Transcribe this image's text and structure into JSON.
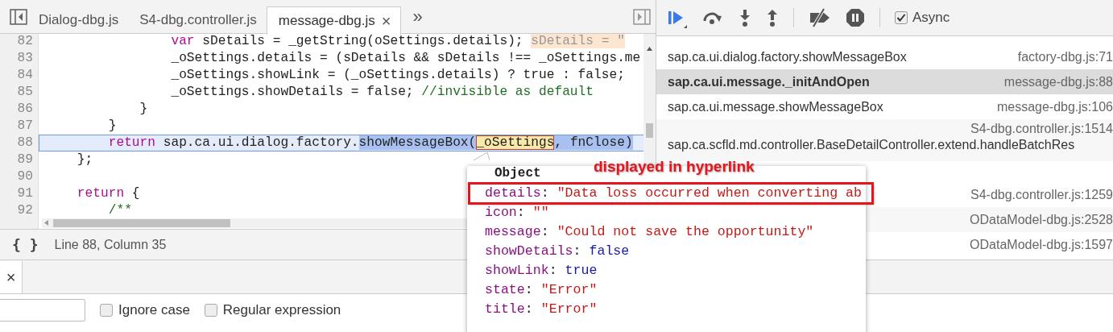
{
  "editor": {
    "tabs": [
      {
        "label": "Dialog-dbg.js",
        "selected": false
      },
      {
        "label": "S4-dbg.controller.js",
        "selected": false
      },
      {
        "label": "message-dbg.js",
        "selected": true,
        "close_glyph": "×"
      }
    ],
    "more_glyph": "»",
    "lines": [
      {
        "number": "82",
        "current": false,
        "segments": [
          {
            "kind": "keyword",
            "text": "                var"
          },
          {
            "kind": "plain",
            "text": " sDetails = _getString(oSettings.details); "
          },
          {
            "kind": "inline-value",
            "text": "sDetails = \""
          }
        ]
      },
      {
        "number": "83",
        "current": false,
        "segments": [
          {
            "kind": "plain",
            "text": "                _oSettings.details = (sDetails && sDetails !== _oSettings.me"
          }
        ]
      },
      {
        "number": "84",
        "current": false,
        "segments": [
          {
            "kind": "plain",
            "text": "                _oSettings.showLink = (_oSettings.details) ? true : false;"
          }
        ]
      },
      {
        "number": "85",
        "current": false,
        "segments": [
          {
            "kind": "plain",
            "text": "                _oSettings.showDetails = false; "
          },
          {
            "kind": "comment",
            "text": "//invisible as default"
          }
        ]
      },
      {
        "number": "86",
        "current": false,
        "segments": [
          {
            "kind": "plain",
            "text": "            }"
          }
        ]
      },
      {
        "number": "87",
        "current": false,
        "segments": [
          {
            "kind": "plain",
            "text": "        }"
          }
        ]
      },
      {
        "number": "88",
        "current": true,
        "segments": [
          {
            "kind": "keyword",
            "text": "        return"
          },
          {
            "kind": "plain",
            "text": " sap.ca.ui.dialog.factory."
          },
          {
            "kind": "selection",
            "text": "showMessageBox("
          },
          {
            "kind": "hover-target",
            "text": "_oSettings"
          },
          {
            "kind": "selection",
            "text": ", fnClose)"
          }
        ]
      },
      {
        "number": "89",
        "current": false,
        "segments": [
          {
            "kind": "plain",
            "text": "    };"
          }
        ]
      },
      {
        "number": "90",
        "current": false
      },
      {
        "number": "91",
        "current": false,
        "segments": [
          {
            "kind": "keyword",
            "text": "    return"
          },
          {
            "kind": "plain",
            "text": " {"
          }
        ]
      },
      {
        "number": "92",
        "current": false,
        "segments": [
          {
            "kind": "comment",
            "text": "        /**"
          }
        ]
      }
    ],
    "status": {
      "format_glyph": "{ }",
      "position": "Line 88, Column 35"
    }
  },
  "debugger": {
    "async": {
      "label": "Async",
      "checked": true
    },
    "call_stack": [
      {
        "function": "sap.ca.ui.dialog.factory.showMessageBox",
        "location": "factory-dbg.js:71",
        "selected": false
      },
      {
        "function": "sap.ca.ui.message._initAndOpen",
        "location": "message-dbg.js:88",
        "selected": true
      },
      {
        "function": "sap.ca.ui.message.showMessageBox",
        "location": "message-dbg.js:106",
        "selected": false
      },
      {
        "function": "sap.ca.scfld.md.controller.BaseDetailController.extend.handleBatchRes",
        "location": "S4-dbg.controller.js:1514",
        "selected": false,
        "wrapped": true
      },
      {
        "location": "S4-dbg.controller.js:1259",
        "selected": false
      },
      {
        "location": "ODataModel-dbg.js:2528",
        "selected": false
      },
      {
        "location": "ODataModel-dbg.js:1597",
        "selected": false
      }
    ]
  },
  "popover": {
    "title": "Object",
    "properties": [
      {
        "key": "details:",
        "value": "\"Data loss occurred when converting ab",
        "kind": "string",
        "highlighted": true
      },
      {
        "key": "icon:",
        "value": "\"\"",
        "kind": "string",
        "highlighted": false
      },
      {
        "key": "message:",
        "value": "\"Could not save the opportunity\"",
        "kind": "string",
        "highlighted": false
      },
      {
        "key": "showDetails:",
        "value": "false",
        "kind": "boolean",
        "highlighted": false
      },
      {
        "key": "showLink:",
        "value": "true",
        "kind": "boolean",
        "highlighted": false
      },
      {
        "key": "state:",
        "value": "\"Error\"",
        "kind": "string",
        "highlighted": false
      },
      {
        "key": "title:",
        "value": "\"Error\"",
        "kind": "string",
        "highlighted": false
      }
    ]
  },
  "annotation": {
    "text": "displayed in hyperlink"
  },
  "drawer": {
    "close_glyph": "×",
    "options": [
      {
        "label": "Ignore case",
        "checked": false
      },
      {
        "label": "Regular expression",
        "checked": false
      }
    ]
  }
}
